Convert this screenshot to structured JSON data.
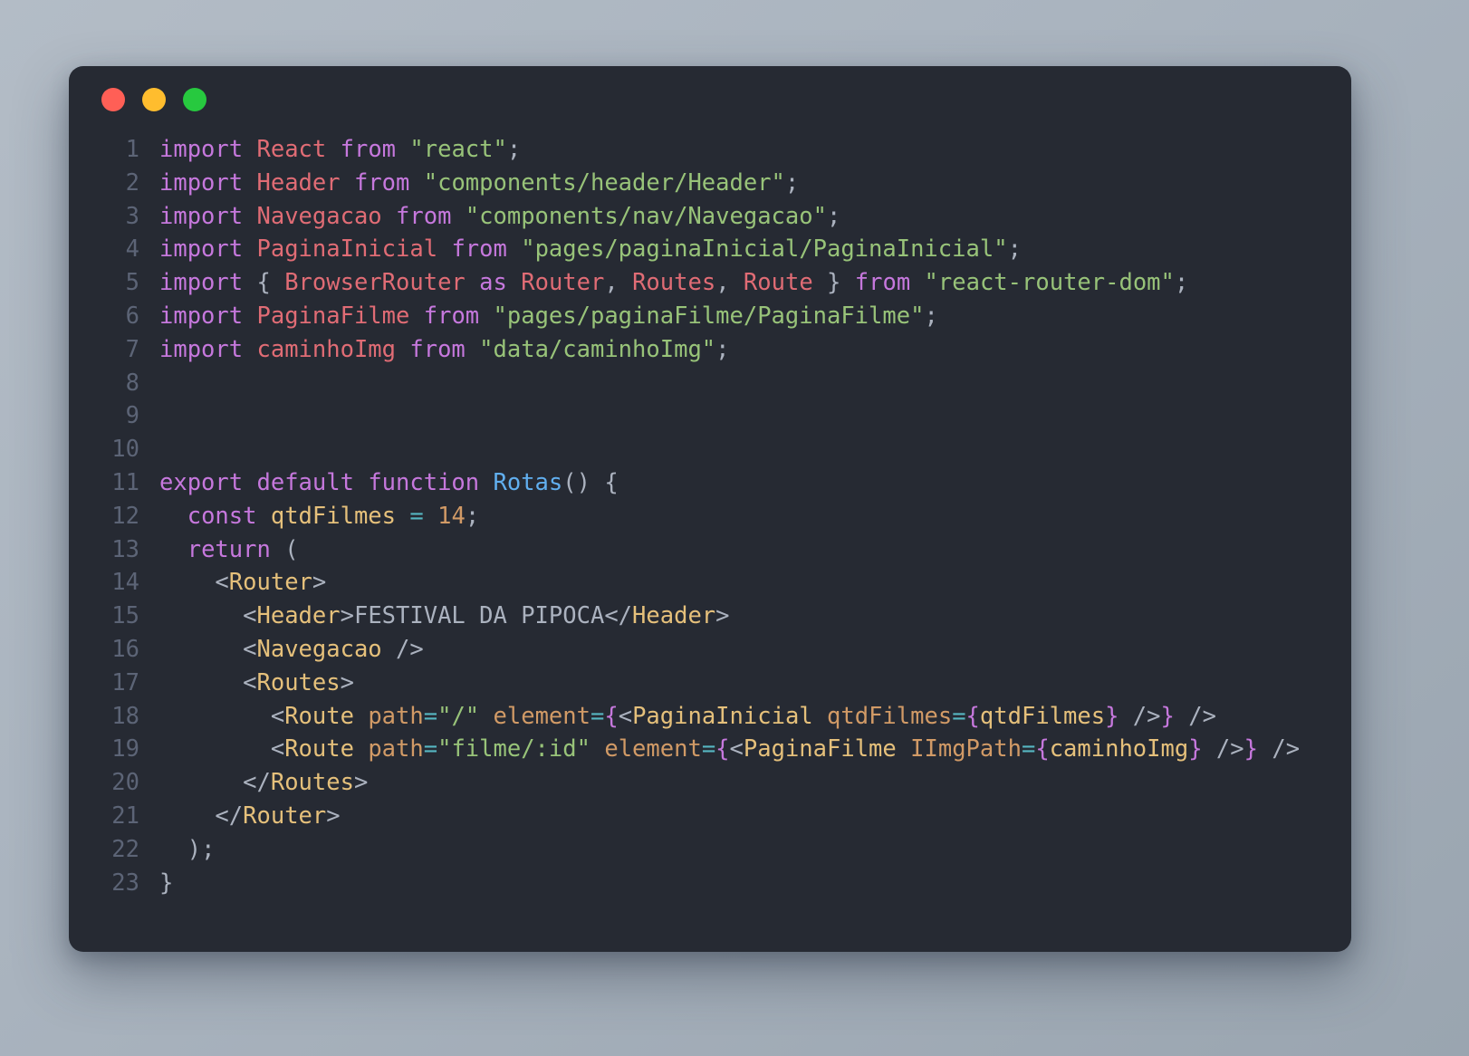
{
  "window": {
    "background_color": "#262a33",
    "page_background": "#aab4bf",
    "controls": [
      {
        "name": "close",
        "color": "#ff5f56"
      },
      {
        "name": "minimize",
        "color": "#ffbd2e"
      },
      {
        "name": "maximize",
        "color": "#27c93f"
      }
    ]
  },
  "editor": {
    "language": "jsx",
    "line_number_color": "#5c6476",
    "colors": {
      "keyword": "#c678dd",
      "identifier": "#e06c75",
      "string": "#98c379",
      "function": "#61afef",
      "variable": "#e5c07b",
      "attribute": "#d19a66",
      "operator": "#56b6c2",
      "punctuation": "#abb2bf",
      "jsx_brace": "#c678dd"
    },
    "lines": [
      {
        "n": "1",
        "text": "import React from \"react\";"
      },
      {
        "n": "2",
        "text": "import Header from \"components/header/Header\";"
      },
      {
        "n": "3",
        "text": "import Navegacao from \"components/nav/Navegacao\";"
      },
      {
        "n": "4",
        "text": "import PaginaInicial from \"pages/paginaInicial/PaginaInicial\";"
      },
      {
        "n": "5",
        "text": "import { BrowserRouter as Router, Routes, Route } from \"react-router-dom\";"
      },
      {
        "n": "6",
        "text": "import PaginaFilme from \"pages/paginaFilme/PaginaFilme\";"
      },
      {
        "n": "7",
        "text": "import caminhoImg from \"data/caminhoImg\";"
      },
      {
        "n": "8",
        "text": ""
      },
      {
        "n": "9",
        "text": ""
      },
      {
        "n": "10",
        "text": ""
      },
      {
        "n": "11",
        "text": "export default function Rotas() {"
      },
      {
        "n": "12",
        "text": "  const qtdFilmes = 14;"
      },
      {
        "n": "13",
        "text": "  return ("
      },
      {
        "n": "14",
        "text": "    <Router>"
      },
      {
        "n": "15",
        "text": "      <Header>FESTIVAL DA PIPOCA</Header>"
      },
      {
        "n": "16",
        "text": "      <Navegacao />"
      },
      {
        "n": "17",
        "text": "      <Routes>"
      },
      {
        "n": "18",
        "text": "        <Route path=\"/\" element={<PaginaInicial qtdFilmes={qtdFilmes} />} />"
      },
      {
        "n": "19",
        "text": "        <Route path=\"filme/:id\" element={<PaginaFilme IImgPath={caminhoImg} />} />"
      },
      {
        "n": "20",
        "text": "      </Routes>"
      },
      {
        "n": "21",
        "text": "    </Router>"
      },
      {
        "n": "22",
        "text": "  );"
      },
      {
        "n": "23",
        "text": "}"
      }
    ],
    "tokens": [
      [
        {
          "t": "import",
          "c": "kw"
        },
        {
          "t": " ",
          "c": "pun"
        },
        {
          "t": "React",
          "c": "id"
        },
        {
          "t": " ",
          "c": "pun"
        },
        {
          "t": "from",
          "c": "kw"
        },
        {
          "t": " ",
          "c": "pun"
        },
        {
          "t": "\"react\"",
          "c": "str"
        },
        {
          "t": ";",
          "c": "pun"
        }
      ],
      [
        {
          "t": "import",
          "c": "kw"
        },
        {
          "t": " ",
          "c": "pun"
        },
        {
          "t": "Header",
          "c": "id"
        },
        {
          "t": " ",
          "c": "pun"
        },
        {
          "t": "from",
          "c": "kw"
        },
        {
          "t": " ",
          "c": "pun"
        },
        {
          "t": "\"components/header/Header\"",
          "c": "str"
        },
        {
          "t": ";",
          "c": "pun"
        }
      ],
      [
        {
          "t": "import",
          "c": "kw"
        },
        {
          "t": " ",
          "c": "pun"
        },
        {
          "t": "Navegacao",
          "c": "id"
        },
        {
          "t": " ",
          "c": "pun"
        },
        {
          "t": "from",
          "c": "kw"
        },
        {
          "t": " ",
          "c": "pun"
        },
        {
          "t": "\"components/nav/Navegacao\"",
          "c": "str"
        },
        {
          "t": ";",
          "c": "pun"
        }
      ],
      [
        {
          "t": "import",
          "c": "kw"
        },
        {
          "t": " ",
          "c": "pun"
        },
        {
          "t": "PaginaInicial",
          "c": "id"
        },
        {
          "t": " ",
          "c": "pun"
        },
        {
          "t": "from",
          "c": "kw"
        },
        {
          "t": " ",
          "c": "pun"
        },
        {
          "t": "\"pages/paginaInicial/PaginaInicial\"",
          "c": "str"
        },
        {
          "t": ";",
          "c": "pun"
        }
      ],
      [
        {
          "t": "import",
          "c": "kw"
        },
        {
          "t": " ",
          "c": "pun"
        },
        {
          "t": "{",
          "c": "pun"
        },
        {
          "t": " ",
          "c": "pun"
        },
        {
          "t": "BrowserRouter",
          "c": "id"
        },
        {
          "t": " ",
          "c": "pun"
        },
        {
          "t": "as",
          "c": "kw"
        },
        {
          "t": " ",
          "c": "pun"
        },
        {
          "t": "Router",
          "c": "id"
        },
        {
          "t": ",",
          "c": "pun"
        },
        {
          "t": " ",
          "c": "pun"
        },
        {
          "t": "Routes",
          "c": "id"
        },
        {
          "t": ",",
          "c": "pun"
        },
        {
          "t": " ",
          "c": "pun"
        },
        {
          "t": "Route",
          "c": "id"
        },
        {
          "t": " ",
          "c": "pun"
        },
        {
          "t": "}",
          "c": "pun"
        },
        {
          "t": " ",
          "c": "pun"
        },
        {
          "t": "from",
          "c": "kw"
        },
        {
          "t": " ",
          "c": "pun"
        },
        {
          "t": "\"react-router-dom\"",
          "c": "str"
        },
        {
          "t": ";",
          "c": "pun"
        }
      ],
      [
        {
          "t": "import",
          "c": "kw"
        },
        {
          "t": " ",
          "c": "pun"
        },
        {
          "t": "PaginaFilme",
          "c": "id"
        },
        {
          "t": " ",
          "c": "pun"
        },
        {
          "t": "from",
          "c": "kw"
        },
        {
          "t": " ",
          "c": "pun"
        },
        {
          "t": "\"pages/paginaFilme/PaginaFilme\"",
          "c": "str"
        },
        {
          "t": ";",
          "c": "pun"
        }
      ],
      [
        {
          "t": "import",
          "c": "kw"
        },
        {
          "t": " ",
          "c": "pun"
        },
        {
          "t": "caminhoImg",
          "c": "id"
        },
        {
          "t": " ",
          "c": "pun"
        },
        {
          "t": "from",
          "c": "kw"
        },
        {
          "t": " ",
          "c": "pun"
        },
        {
          "t": "\"data/caminhoImg\"",
          "c": "str"
        },
        {
          "t": ";",
          "c": "pun"
        }
      ],
      [],
      [],
      [],
      [
        {
          "t": "export",
          "c": "kw"
        },
        {
          "t": " ",
          "c": "pun"
        },
        {
          "t": "default",
          "c": "kw"
        },
        {
          "t": " ",
          "c": "pun"
        },
        {
          "t": "function",
          "c": "kw"
        },
        {
          "t": " ",
          "c": "pun"
        },
        {
          "t": "Rotas",
          "c": "fn"
        },
        {
          "t": "() {",
          "c": "pun"
        }
      ],
      [
        {
          "t": "  ",
          "c": "pun"
        },
        {
          "t": "const",
          "c": "kw"
        },
        {
          "t": " ",
          "c": "pun"
        },
        {
          "t": "qtdFilmes",
          "c": "var"
        },
        {
          "t": " ",
          "c": "pun"
        },
        {
          "t": "=",
          "c": "op"
        },
        {
          "t": " ",
          "c": "pun"
        },
        {
          "t": "14",
          "c": "num"
        },
        {
          "t": ";",
          "c": "pun"
        }
      ],
      [
        {
          "t": "  ",
          "c": "pun"
        },
        {
          "t": "return",
          "c": "kw"
        },
        {
          "t": " ",
          "c": "pun"
        },
        {
          "t": "(",
          "c": "pun"
        }
      ],
      [
        {
          "t": "    ",
          "c": "pun"
        },
        {
          "t": "<",
          "c": "pun"
        },
        {
          "t": "Router",
          "c": "var"
        },
        {
          "t": ">",
          "c": "pun"
        }
      ],
      [
        {
          "t": "      ",
          "c": "pun"
        },
        {
          "t": "<",
          "c": "pun"
        },
        {
          "t": "Header",
          "c": "var"
        },
        {
          "t": ">",
          "c": "pun"
        },
        {
          "t": "FESTIVAL DA PIPOCA",
          "c": "txt"
        },
        {
          "t": "</",
          "c": "pun"
        },
        {
          "t": "Header",
          "c": "var"
        },
        {
          "t": ">",
          "c": "pun"
        }
      ],
      [
        {
          "t": "      ",
          "c": "pun"
        },
        {
          "t": "<",
          "c": "pun"
        },
        {
          "t": "Navegacao",
          "c": "var"
        },
        {
          "t": " />",
          "c": "pun"
        }
      ],
      [
        {
          "t": "      ",
          "c": "pun"
        },
        {
          "t": "<",
          "c": "pun"
        },
        {
          "t": "Routes",
          "c": "var"
        },
        {
          "t": ">",
          "c": "pun"
        }
      ],
      [
        {
          "t": "        ",
          "c": "pun"
        },
        {
          "t": "<",
          "c": "pun"
        },
        {
          "t": "Route",
          "c": "var"
        },
        {
          "t": " ",
          "c": "pun"
        },
        {
          "t": "path",
          "c": "attr"
        },
        {
          "t": "=",
          "c": "op"
        },
        {
          "t": "\"/\"",
          "c": "str"
        },
        {
          "t": " ",
          "c": "pun"
        },
        {
          "t": "element",
          "c": "attr"
        },
        {
          "t": "=",
          "c": "op"
        },
        {
          "t": "{",
          "c": "brace"
        },
        {
          "t": "<",
          "c": "pun"
        },
        {
          "t": "PaginaInicial",
          "c": "var"
        },
        {
          "t": " ",
          "c": "pun"
        },
        {
          "t": "qtdFilmes",
          "c": "attr"
        },
        {
          "t": "=",
          "c": "op"
        },
        {
          "t": "{",
          "c": "brace"
        },
        {
          "t": "qtdFilmes",
          "c": "var"
        },
        {
          "t": "}",
          "c": "brace"
        },
        {
          "t": " />",
          "c": "pun"
        },
        {
          "t": "}",
          "c": "brace"
        },
        {
          "t": " />",
          "c": "pun"
        }
      ],
      [
        {
          "t": "        ",
          "c": "pun"
        },
        {
          "t": "<",
          "c": "pun"
        },
        {
          "t": "Route",
          "c": "var"
        },
        {
          "t": " ",
          "c": "pun"
        },
        {
          "t": "path",
          "c": "attr"
        },
        {
          "t": "=",
          "c": "op"
        },
        {
          "t": "\"filme/:id\"",
          "c": "str"
        },
        {
          "t": " ",
          "c": "pun"
        },
        {
          "t": "element",
          "c": "attr"
        },
        {
          "t": "=",
          "c": "op"
        },
        {
          "t": "{",
          "c": "brace"
        },
        {
          "t": "<",
          "c": "pun"
        },
        {
          "t": "PaginaFilme",
          "c": "var"
        },
        {
          "t": " ",
          "c": "pun"
        },
        {
          "t": "IImgPath",
          "c": "attr"
        },
        {
          "t": "=",
          "c": "op"
        },
        {
          "t": "{",
          "c": "brace"
        },
        {
          "t": "caminhoImg",
          "c": "var"
        },
        {
          "t": "}",
          "c": "brace"
        },
        {
          "t": " />",
          "c": "pun"
        },
        {
          "t": "}",
          "c": "brace"
        },
        {
          "t": " />",
          "c": "pun"
        }
      ],
      [
        {
          "t": "      ",
          "c": "pun"
        },
        {
          "t": "</",
          "c": "pun"
        },
        {
          "t": "Routes",
          "c": "var"
        },
        {
          "t": ">",
          "c": "pun"
        }
      ],
      [
        {
          "t": "    ",
          "c": "pun"
        },
        {
          "t": "</",
          "c": "pun"
        },
        {
          "t": "Router",
          "c": "var"
        },
        {
          "t": ">",
          "c": "pun"
        }
      ],
      [
        {
          "t": "  ",
          "c": "pun"
        },
        {
          "t": ");",
          "c": "pun"
        }
      ],
      [
        {
          "t": "}",
          "c": "pun"
        }
      ]
    ]
  }
}
